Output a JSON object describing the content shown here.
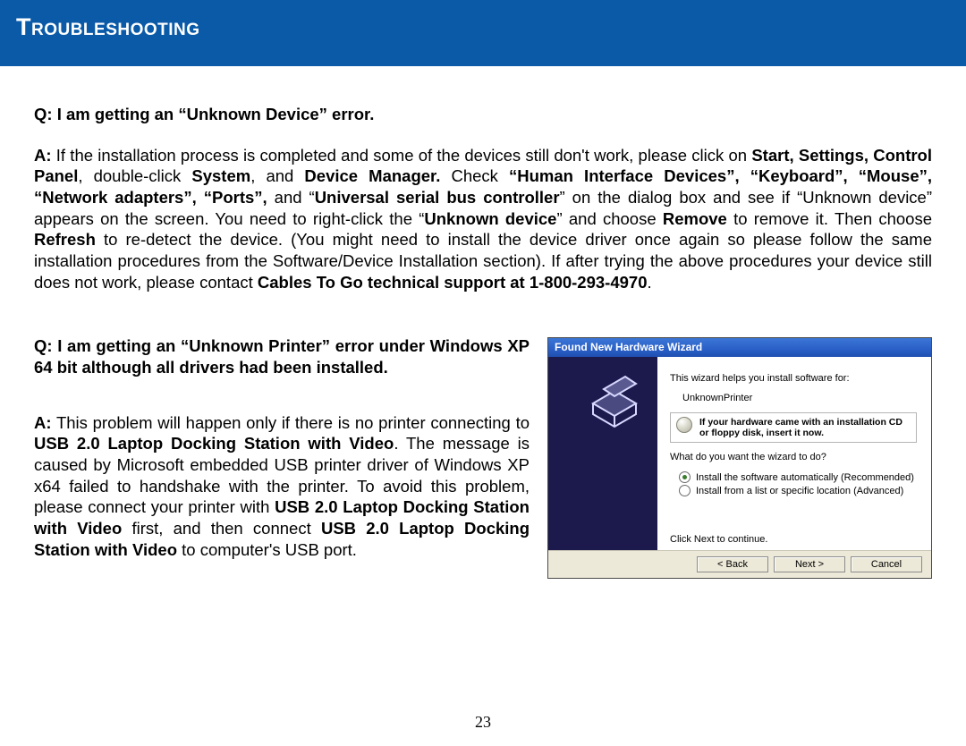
{
  "header": {
    "title": "Troubleshooting"
  },
  "faq1": {
    "question": "Q: I am getting an “Unknown Device” error.",
    "answer_html": "If the installation process is completed and some of the devices still don't work, please click on <b>Start, Settings, Control Panel</b>, double-click <b>System</b>, and <b>Device Manager.</b> Check <b>“Human Interface Devices”, “Keyboard”, “Mouse”, “Network adapters”, “Ports”,</b> and “<b>Universal serial bus controller</b>” on the dialog box and see if “Unknown device” appears on the screen. You need to right-click the “<b>Unknown device</b>” and choose <b>Remove</b> to remove it. Then choose <b>Refresh</b> to re-detect the device. (You might need to install the device driver once again so please follow the same installation procedures from the Software/Device Installation section). If after trying the above procedures your device still does not work, please contact <b>Cables To Go technical support at 1-800-293-4970</b>."
  },
  "faq2": {
    "question": "Q: I am getting an “Unknown Printer” error under Windows XP 64 bit although all drivers had been installed.",
    "answer_html": "This problem will happen only if there is no printer connecting to <b>USB 2.0 Laptop Docking Station with Video</b>. The message is caused by Microsoft embedded USB printer driver of Windows XP x64 failed to handshake with the printer. To avoid this problem, please connect your printer with <b>USB 2.0 Laptop Docking Station with Video</b> first, and then connect <b>USB 2.0 Laptop Docking Station with Video</b> to computer's USB port."
  },
  "wizard": {
    "title": "Found New Hardware Wizard",
    "line1": "This wizard helps you install software for:",
    "device": "UnknownPrinter",
    "cd_notice": "If your hardware came with an installation CD or floppy disk, insert it now.",
    "prompt": "What do you want the wizard to do?",
    "opt1": "Install the software automatically (Recommended)",
    "opt2": "Install from a list or specific location (Advanced)",
    "cont": "Click Next to continue.",
    "back": "< Back",
    "next": "Next >",
    "cancel": "Cancel"
  },
  "page_number": "23"
}
